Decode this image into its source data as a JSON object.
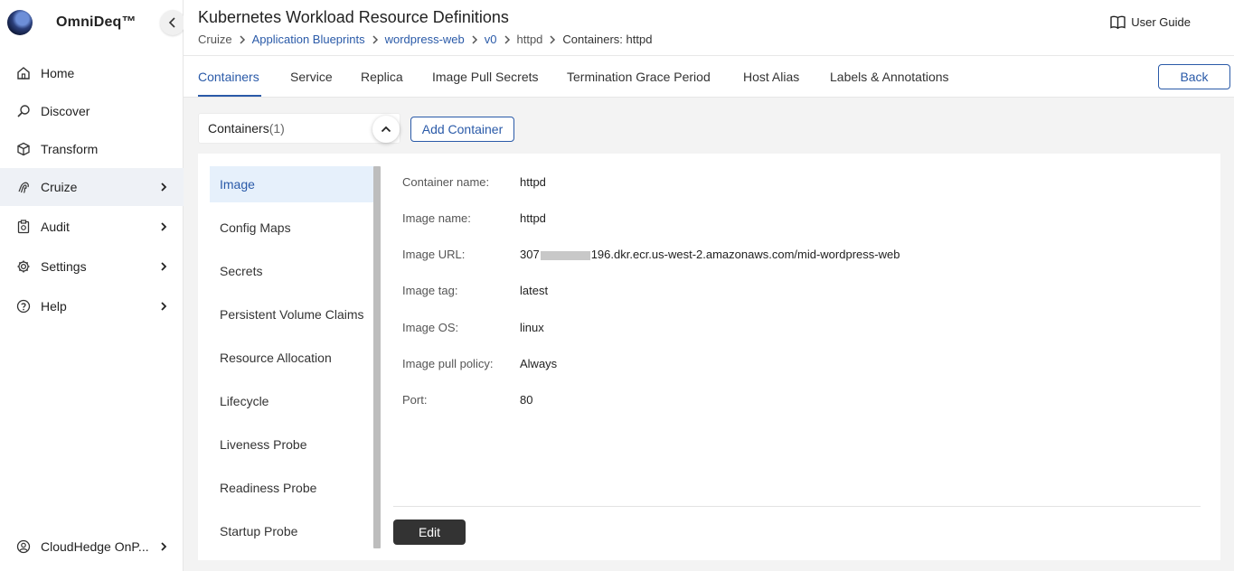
{
  "app": {
    "name": "OmniDeq™"
  },
  "sidebar": {
    "items": [
      {
        "label": "Home",
        "icon": "home-icon"
      },
      {
        "label": "Discover",
        "icon": "discover-icon"
      },
      {
        "label": "Transform",
        "icon": "cube-icon"
      },
      {
        "label": "Cruize",
        "icon": "fingerprint-icon",
        "active": true
      },
      {
        "label": "Audit",
        "icon": "clipboard-icon"
      },
      {
        "label": "Settings",
        "icon": "gear-icon"
      },
      {
        "label": "Help",
        "icon": "help-icon"
      }
    ],
    "account": {
      "label": "CloudHedge OnP...",
      "icon": "user-icon"
    }
  },
  "header": {
    "title": "Kubernetes Workload Resource Definitions",
    "breadcrumb": [
      "Cruize",
      "Application Blueprints",
      "wordpress-web",
      "v0",
      "httpd",
      "Containers: httpd"
    ],
    "user_guide": "User Guide"
  },
  "tabs": [
    "Containers",
    "Service",
    "Replica",
    "Image Pull Secrets",
    "Termination Grace Period",
    "Host Alias",
    "Labels & Annotations"
  ],
  "back_label": "Back",
  "containers": {
    "label": "Containers",
    "count": "(1)",
    "add_label": "Add Container"
  },
  "subnav": [
    "Image",
    "Config Maps",
    "Secrets",
    "Persistent Volume Claims",
    "Resource Allocation",
    "Lifecycle",
    "Liveness Probe",
    "Readiness Probe",
    "Startup Probe"
  ],
  "details": {
    "container_name": {
      "key": "Container name:",
      "value": "httpd"
    },
    "image_name": {
      "key": "Image name:",
      "value": "httpd"
    },
    "image_url": {
      "key": "Image URL:",
      "prefix": "307",
      "suffix": "196.dkr.ecr.us-west-2.amazonaws.com/mid-wordpress-web"
    },
    "image_tag": {
      "key": "Image tag:",
      "value": "latest"
    },
    "image_os": {
      "key": "Image OS:",
      "value": "linux"
    },
    "image_pull_policy": {
      "key": "Image pull policy:",
      "value": "Always"
    },
    "port": {
      "key": "Port:",
      "value": "80"
    }
  },
  "edit_label": "Edit",
  "colors": {
    "accent": "#2a5aa8",
    "active_bg": "#e6f0fb",
    "edit_bg": "#333333"
  }
}
